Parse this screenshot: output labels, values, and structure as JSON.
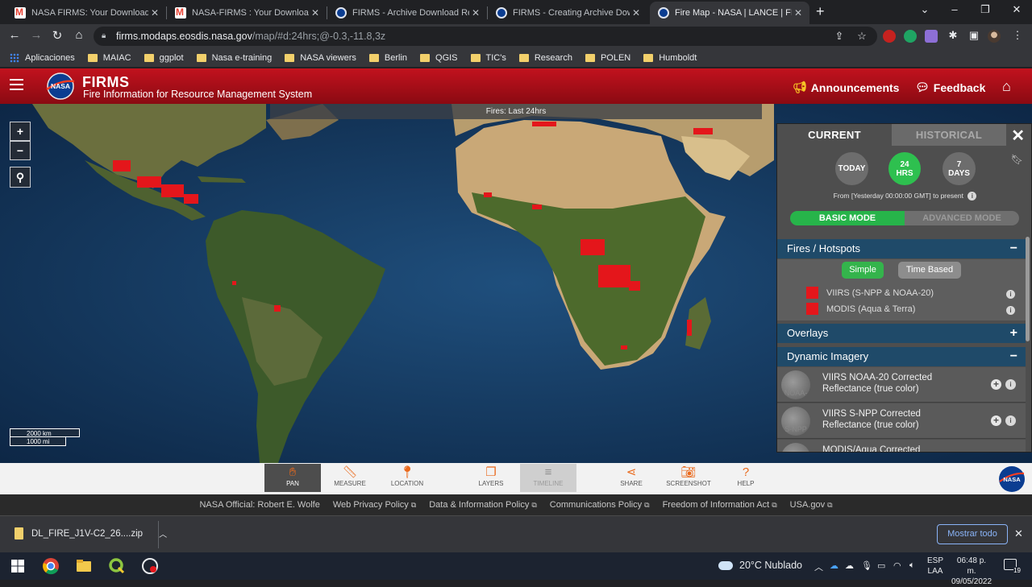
{
  "browser": {
    "tabs": [
      {
        "title": "NASA FIRMS: Your Download Re",
        "icon": "gmail-icon"
      },
      {
        "title": "NASA-FIRMS : Your Download Re",
        "icon": "gmail-icon"
      },
      {
        "title": "FIRMS - Archive Download Requ",
        "icon": "nasa-icon"
      },
      {
        "title": "FIRMS - Creating Archive Downlo",
        "icon": "nasa-icon"
      },
      {
        "title": "Fire Map - NASA | LANCE | FIRMS",
        "icon": "nasa-icon",
        "active": true
      }
    ],
    "url_host": "firms.modaps.eosdis.nasa.gov",
    "url_path": "/map/#d:24hrs;@-0.3,-11.8,3z",
    "bookmarks": [
      "Aplicaciones",
      "MAIAC",
      "ggplot",
      "Nasa e-training",
      "NASA viewers",
      "Berlin",
      "QGIS",
      "TIC's",
      "Research",
      "POLEN",
      "Humboldt"
    ]
  },
  "header": {
    "title": "FIRMS",
    "subtitle": "Fire Information for Resource Management System",
    "announcements": "Announcements",
    "feedback": "Feedback"
  },
  "map": {
    "banner": "Fires: Last 24hrs",
    "zoom_in": "+",
    "zoom_out": "−",
    "scale_km": "2000 km",
    "scale_mi": "1000 mi"
  },
  "panel": {
    "tab_current": "CURRENT",
    "tab_historical": "HISTORICAL",
    "periods": [
      "TODAY",
      "24 HRS",
      "7 DAYS"
    ],
    "selected_period": "24 HRS",
    "from_text": "From [Yesterday 00:00:00 GMT] to present",
    "basic_mode": "BASIC MODE",
    "advanced_mode": "ADVANCED MODE",
    "fires_section": "Fires / Hotspots",
    "simple": "Simple",
    "time_based": "Time Based",
    "legend": [
      {
        "label": "VIIRS (S-NPP & NOAA-20)",
        "color": "#e4161b"
      },
      {
        "label": "MODIS (Aqua & Terra)",
        "color": "#e4161b"
      }
    ],
    "overlays_section": "Overlays",
    "dynamic_section": "Dynamic Imagery",
    "imagery": [
      {
        "label": "VIIRS NOAA-20 Corrected Reflectance (true color)",
        "thumb": "NOAA-20"
      },
      {
        "label": "VIIRS S-NPP Corrected Reflectance (true color)",
        "thumb": "S-NPP"
      },
      {
        "label": "MODIS/Aqua Corrected",
        "thumb": ""
      }
    ]
  },
  "tools": [
    {
      "label": "PAN",
      "icon": "hand-icon",
      "state": "active"
    },
    {
      "label": "MEASURE",
      "icon": "ruler-icon",
      "state": "normal"
    },
    {
      "label": "LOCATION",
      "icon": "pin-icon",
      "state": "normal"
    },
    {
      "label": "LAYERS",
      "icon": "layers-icon",
      "state": "normal"
    },
    {
      "label": "TIMELINE",
      "icon": "timeline-icon",
      "state": "disabled"
    },
    {
      "label": "SHARE",
      "icon": "share-icon",
      "state": "normal"
    },
    {
      "label": "SCREENSHOT",
      "icon": "camera-icon",
      "state": "normal"
    },
    {
      "label": "HELP",
      "icon": "question-icon",
      "state": "normal"
    }
  ],
  "footer": [
    "NASA Official: Robert E. Wolfe",
    "Web Privacy Policy",
    "Data & Information Policy",
    "Communications Policy",
    "Freedom of Information Act",
    "USA.gov"
  ],
  "download": {
    "file": "DL_FIRE_J1V-C2_26....zip",
    "show_all": "Mostrar todo"
  },
  "taskbar": {
    "weather": "20°C  Nublado",
    "lang_top": "ESP",
    "lang_bottom": "LAA",
    "time": "06:48 p. m.",
    "date": "09/05/2022",
    "notifications": "19"
  },
  "colors": {
    "header_red": "#b10f1a",
    "fire_red": "#e4161b",
    "section_blue": "#1f4a69",
    "mode_green": "#27b44a",
    "tool_orange": "#ea6a1d"
  }
}
